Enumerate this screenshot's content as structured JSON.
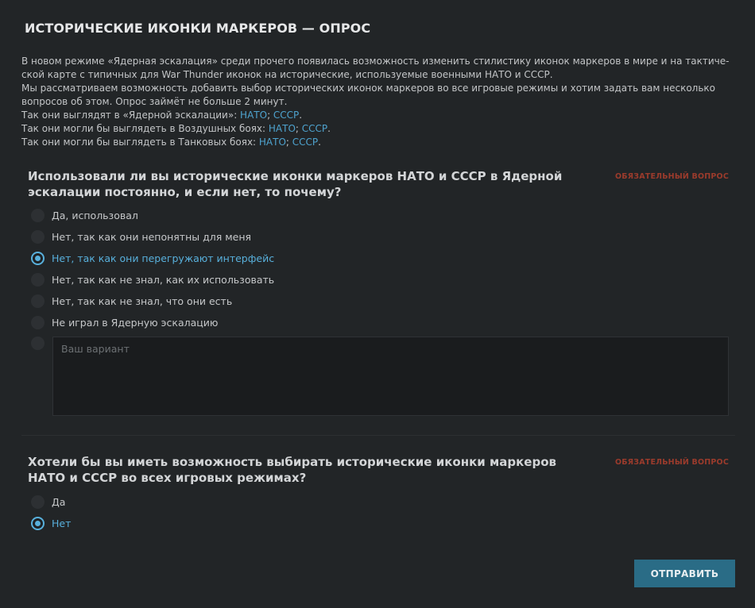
{
  "survey": {
    "title": "ИСТОРИЧЕСКИЕ ИКОНКИ МАРКЕРОВ — ОПРОС",
    "intro": {
      "line1": "В новом режиме «Ядерная эскалация» среди прочего появилась возможность изменить стилистику иконок маркеров в мире и на тактиче-ской карте с типичных для War Thunder иконок на исторические, используемые военными НАТО и СССР.",
      "line2": "Мы рассматриваем возможность добавить выбор исторических иконок маркеров во все игровые режимы и хотим задать вам несколько вопросов об этом. Опрос займёт не больше 2 минут.",
      "nuclear_prefix": "Так они выглядят в «Ядерной эскалации»: ",
      "air_prefix": "Так они могли бы выглядеть в Воздушных боях: ",
      "tank_prefix": "Так они могли бы выглядеть в Танковых боях: ",
      "link_nato": "НАТО",
      "link_ussr": "СССР",
      "separator": "; ",
      "end": "."
    }
  },
  "question1": {
    "text": "Использовали ли вы исторические иконки маркеров НАТО и СССР в Ядерной эскалации постоянно, и если нет, то почему?",
    "required_label": "ОБЯЗАТЕЛЬНЫЙ ВОПРОС",
    "options": [
      {
        "label": "Да, использовал",
        "selected": false
      },
      {
        "label": "Нет, так как они непонятны для меня",
        "selected": false
      },
      {
        "label": "Нет, так как они перегружают интерфейс",
        "selected": true
      },
      {
        "label": "Нет, так как не знал, как их использовать",
        "selected": false
      },
      {
        "label": "Нет, так как не знал, что они есть",
        "selected": false
      },
      {
        "label": "Не играл в Ядерную эскалацию",
        "selected": false
      }
    ],
    "other_placeholder": "Ваш вариант"
  },
  "question2": {
    "text": "Хотели бы вы иметь возможность выбирать исторические иконки маркеров НАТО и СССР во всех игровых режимах?",
    "required_label": "ОБЯЗАТЕЛЬНЫЙ ВОПРОС",
    "options": [
      {
        "label": "Да",
        "selected": false
      },
      {
        "label": "Нет",
        "selected": true
      }
    ]
  },
  "submit_label": "ОТПРАВИТЬ",
  "colors": {
    "accent": "#58b0dc",
    "link": "#4ea3cf",
    "required": "#9b3b2c",
    "button": "#2a6c86"
  }
}
